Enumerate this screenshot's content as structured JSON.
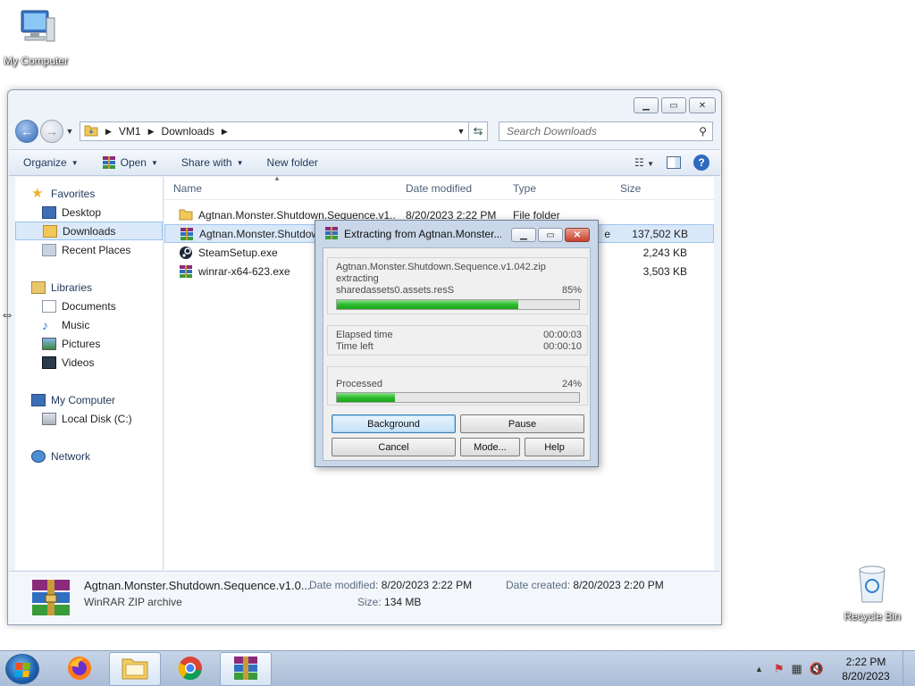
{
  "desktop": {
    "my_computer_label": "My Computer",
    "recycle_bin_label": "Recycle Bin"
  },
  "explorer": {
    "caption_buttons": [
      "minimize",
      "maximize",
      "close"
    ],
    "address": {
      "crumbs": [
        "VM1",
        "Downloads"
      ]
    },
    "search_placeholder": "Search Downloads",
    "commands": {
      "organize": "Organize",
      "open": "Open",
      "share_with": "Share with",
      "new_folder": "New folder"
    },
    "nav": {
      "favorites": "Favorites",
      "desktop": "Desktop",
      "downloads": "Downloads",
      "recent_places": "Recent Places",
      "libraries": "Libraries",
      "documents": "Documents",
      "music": "Music",
      "pictures": "Pictures",
      "videos": "Videos",
      "my_computer": "My Computer",
      "local_disk": "Local Disk (C:)",
      "network": "Network"
    },
    "columns": {
      "name": "Name",
      "date_modified": "Date modified",
      "type": "Type",
      "size": "Size"
    },
    "files": [
      {
        "name": "Agtnan.Monster.Shutdown.Sequence.v1....",
        "date": "8/20/2023 2:22 PM",
        "type": "File folder",
        "size": "",
        "icon": "folder-icon"
      },
      {
        "name": "Agtnan.Monster.Shutdown.Sequence.v1.042.zip",
        "date": "",
        "type": "e",
        "size": "137,502 KB",
        "icon": "winrar-icon"
      },
      {
        "name": "SteamSetup.exe",
        "date": "",
        "type": "",
        "size": "2,243 KB",
        "icon": "steam-icon"
      },
      {
        "name": "winrar-x64-623.exe",
        "date": "",
        "type": "",
        "size": "3,503 KB",
        "icon": "winrar-icon"
      }
    ],
    "details": {
      "name": "Agtnan.Monster.Shutdown.Sequence.v1.0...",
      "type": "WinRAR ZIP archive",
      "date_modified_label": "Date modified:",
      "date_modified": "8/20/2023 2:22 PM",
      "size_label": "Size:",
      "size": "134 MB",
      "date_created_label": "Date created:",
      "date_created": "8/20/2023 2:20 PM"
    }
  },
  "rar_dialog": {
    "title": "Extracting from Agtnan.Monster...",
    "archive": "Agtnan.Monster.Shutdown.Sequence.v1.042.zip",
    "action": "extracting",
    "current_file": "sharedassets0.assets.resS",
    "file_percent_label": "85%",
    "file_progress": 0.75,
    "elapsed_label": "Elapsed time",
    "elapsed": "00:00:03",
    "time_left_label": "Time left",
    "time_left": "00:00:10",
    "processed_label": "Processed",
    "processed_percent_label": "24%",
    "processed_progress": 0.24,
    "buttons": {
      "background": "Background",
      "pause": "Pause",
      "cancel": "Cancel",
      "mode": "Mode...",
      "help": "Help"
    }
  },
  "taskbar": {
    "time": "2:22 PM",
    "date": "8/20/2023",
    "pinned": [
      "firefox-icon",
      "explorer-icon",
      "chrome-icon",
      "winrar-icon"
    ]
  }
}
